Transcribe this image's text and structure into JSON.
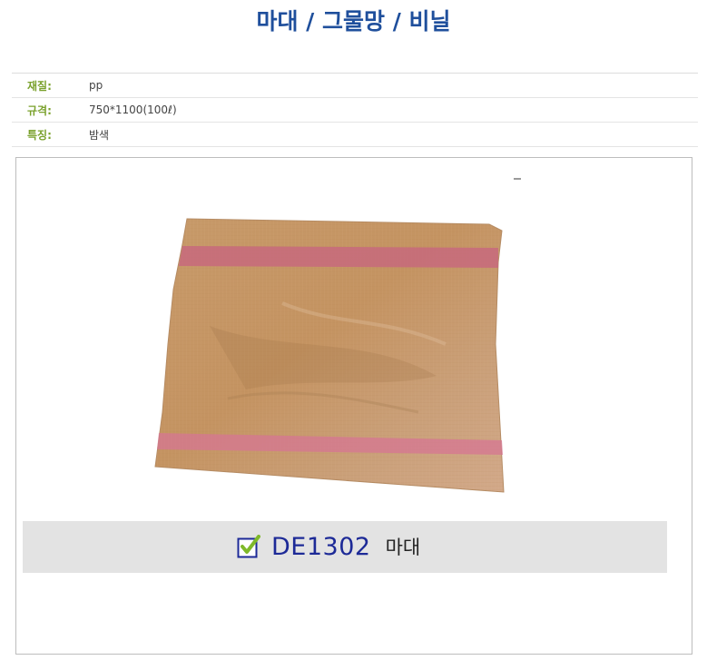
{
  "header": {
    "title": "마대 / 그물망 / 비닐"
  },
  "specs": [
    {
      "label": "재질:",
      "value": "pp"
    },
    {
      "label": "규격:",
      "value": "750*1100(100ℓ)"
    },
    {
      "label": "특징:",
      "value": "밤색"
    }
  ],
  "product": {
    "image_name": "woven-polypropylene-sack-photo",
    "code": "DE1302",
    "name": "마대",
    "check_icon": "checkbox-checked-icon",
    "colors": {
      "title": "#1f4f9c",
      "label": "#7aa12c",
      "code": "#1d2a97",
      "check": "#7fb92a"
    }
  }
}
